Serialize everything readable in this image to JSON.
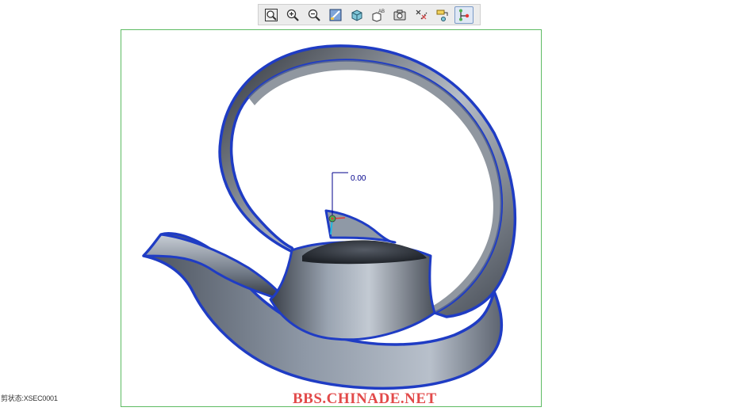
{
  "toolbar": {
    "buttons": [
      {
        "name": "zoom-fit",
        "icon": "zoom-fit-icon"
      },
      {
        "name": "zoom-in",
        "icon": "zoom-in-icon"
      },
      {
        "name": "zoom-out",
        "icon": "zoom-out-icon"
      },
      {
        "name": "repaint",
        "icon": "repaint-icon"
      },
      {
        "name": "display-style",
        "icon": "cube-icon"
      },
      {
        "name": "saved-views",
        "icon": "saved-views-icon"
      },
      {
        "name": "view-manager",
        "icon": "camera-icon"
      },
      {
        "name": "datum-display",
        "icon": "datum-filter-icon"
      },
      {
        "name": "annotation-display",
        "icon": "annotation-icon"
      },
      {
        "name": "spin-center",
        "icon": "spin-center-icon"
      }
    ],
    "active_index": 9
  },
  "viewport": {
    "dimension_value": "0.00",
    "colors": {
      "edge": "#1f3cc4",
      "surface_light": "#aab4c1",
      "surface_dark": "#2b2f36",
      "frame": "#5dbb63"
    }
  },
  "status": {
    "text": "剪状态:XSEC0001"
  },
  "watermark": {
    "text": "BBS.CHINADE.NET"
  }
}
